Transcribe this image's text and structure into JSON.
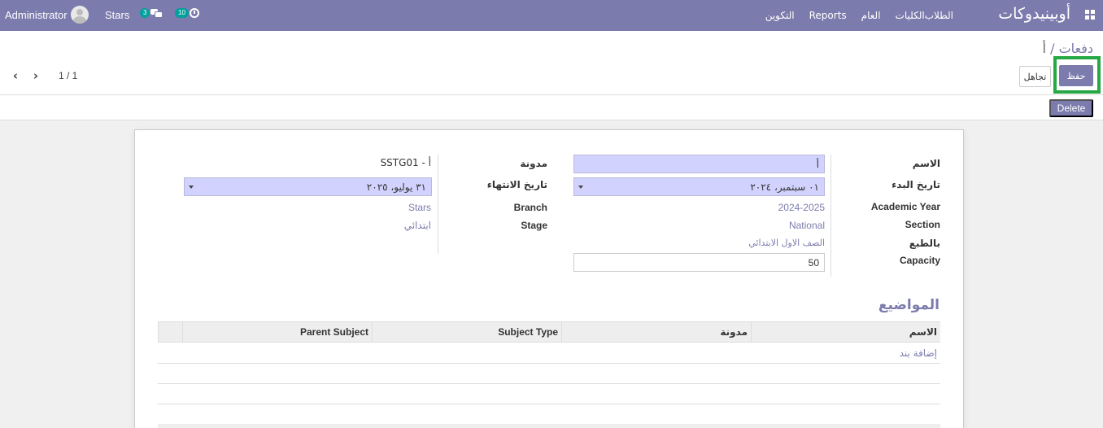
{
  "navbar": {
    "brand": "أوبينيدوكات",
    "menu": [
      "الطلاب",
      "الكليات",
      "العام",
      "Reports",
      "التكوين"
    ],
    "user": "Administrator",
    "company": "Stars",
    "messages_count": "3",
    "activities_count": "10"
  },
  "control": {
    "breadcrumb_parent": "دفعات",
    "breadcrumb_sep": " / ",
    "breadcrumb_current": "أ",
    "save_label": "حفظ",
    "discard_label": "تجاهل",
    "pager": "1 / 1",
    "delete_label": "Delete"
  },
  "form": {
    "name_label": "الاسم",
    "name_value": "أ",
    "code_label": "مدونة",
    "code_value": "SSTG01 - أ",
    "start_label": "تاريخ البدء",
    "start_value": "٠١ سبتمبر، ٢٠٢٤",
    "end_label": "تاريخ الانتهاء",
    "end_value": "٣١ يوليو، ٢٠٢٥",
    "year_label": "Academic Year",
    "year_value": "2024-2025",
    "branch_label": "Branch",
    "branch_value": "Stars",
    "section_label": "Section",
    "section_value": "National",
    "stage_label": "Stage",
    "stage_value": "ابتدائي",
    "grade_label": "بالطبع",
    "grade_value": "الصف الاول الابتدائي",
    "capacity_label": "Capacity",
    "capacity_value": "50"
  },
  "subjects": {
    "title": "المواضيع",
    "columns": [
      "الاسم",
      "مدونة",
      "Subject Type",
      "Parent Subject"
    ],
    "add_line": "إضافة بند"
  }
}
